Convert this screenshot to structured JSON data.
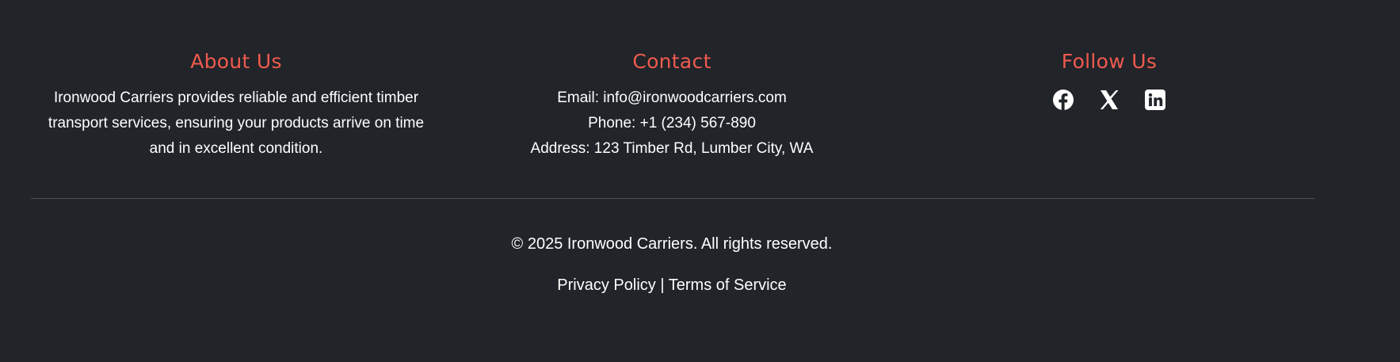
{
  "about": {
    "heading": "About Us",
    "text_lines": [
      "Ironwood Carriers provides reliable and efficient timber",
      "transport services, ensuring your products arrive on time",
      "and in excellent condition."
    ]
  },
  "contact": {
    "heading": "Contact",
    "email": "Email: info@ironwoodcarriers.com",
    "phone": "Phone: +1 (234) 567-890",
    "address": "Address: 123 Timber Rd, Lumber City, WA"
  },
  "follow": {
    "heading": "Follow Us",
    "icons": [
      "facebook-icon",
      "x-icon",
      "linkedin-icon"
    ]
  },
  "bottom": {
    "copyright": "© 2025 Ironwood Carriers. All rights reserved.",
    "privacy": "Privacy Policy",
    "separator": "|",
    "terms": "Terms of Service"
  },
  "colors": {
    "background": "#212429",
    "accent": "#ef5a4f",
    "text": "#ffffff",
    "divider": "#4d5157"
  }
}
